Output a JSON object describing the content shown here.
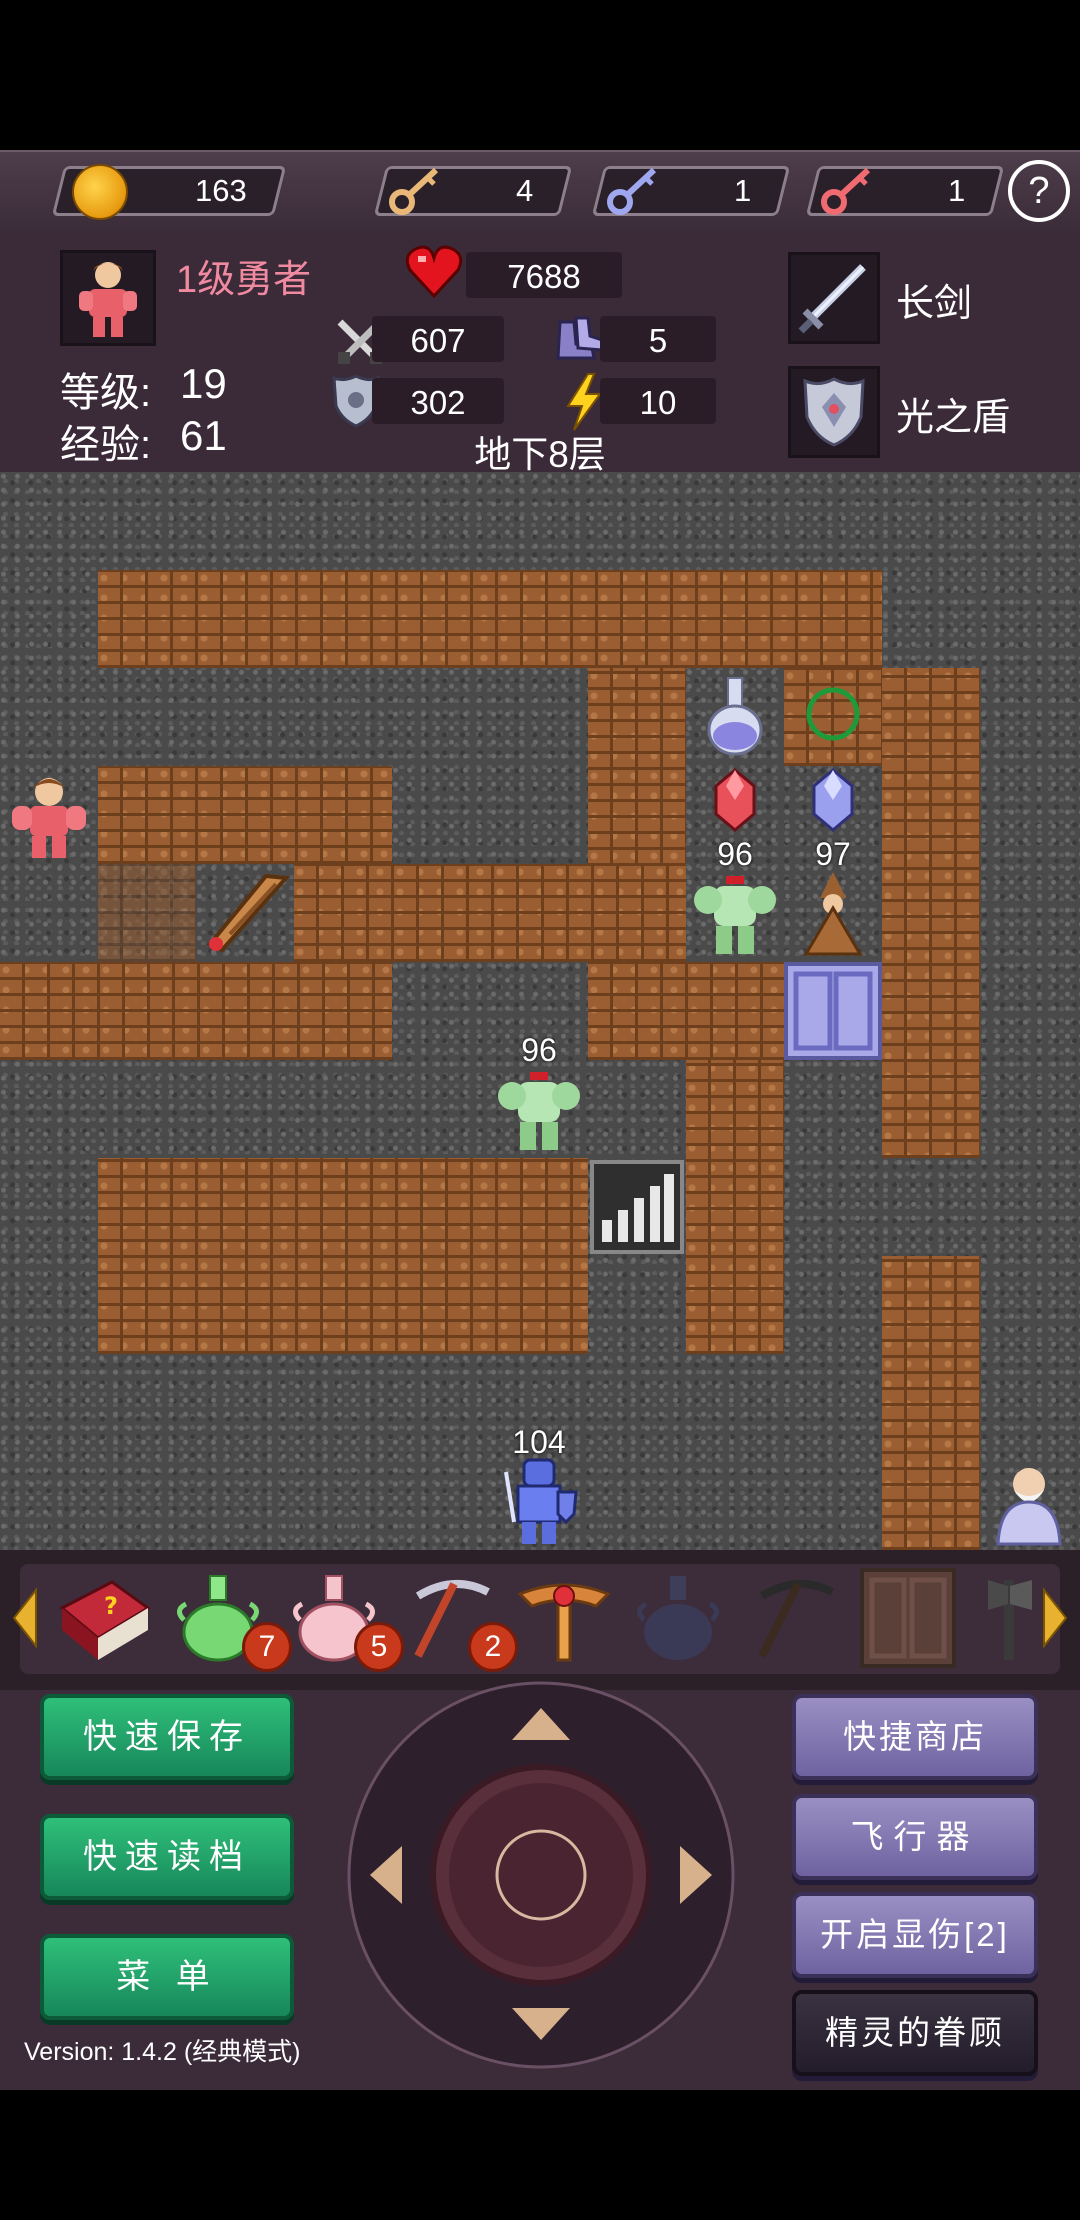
{
  "resources": {
    "gold": "163",
    "yellow_keys": "4",
    "blue_keys": "1",
    "red_keys": "1",
    "help": "?"
  },
  "hero": {
    "title": "1级勇者",
    "level_label": "等级:",
    "level": "19",
    "exp_label": "经验:",
    "exp": "61",
    "hp": "7688",
    "attack": "607",
    "speed": "5",
    "defense": "302",
    "magic": "10",
    "weapon": "长剑",
    "shield": "光之盾"
  },
  "floor": "地下8层",
  "map_labels": {
    "guard_top": "96",
    "wizard": "97",
    "guard_mid": "96",
    "knight": "104"
  },
  "items": [
    {
      "name": "monster-book",
      "count": ""
    },
    {
      "name": "green-potion",
      "count": "7"
    },
    {
      "name": "pink-potion",
      "count": "5"
    },
    {
      "name": "pickaxe",
      "count": "2"
    },
    {
      "name": "cross-medal",
      "count": ""
    },
    {
      "name": "dark-vase",
      "count": ""
    },
    {
      "name": "dark-pickaxe",
      "count": ""
    },
    {
      "name": "door-item",
      "count": ""
    },
    {
      "name": "axe",
      "count": ""
    }
  ],
  "buttons": {
    "quick_save": "快速保存",
    "quick_load": "快速读档",
    "menu": "菜 单",
    "shop": "快捷商店",
    "flyer": "飞行器",
    "damage": "开启显伤[2]",
    "spirit": "精灵的眷顾"
  },
  "version": "Version: 1.4.2 (经典模式)",
  "colors": {
    "hero_title": "#f08aa0",
    "wall": "#9a5e32",
    "floor": "#4a4a4a",
    "green_button": "#2fbf7a",
    "purple_button": "#9a8fc3"
  }
}
